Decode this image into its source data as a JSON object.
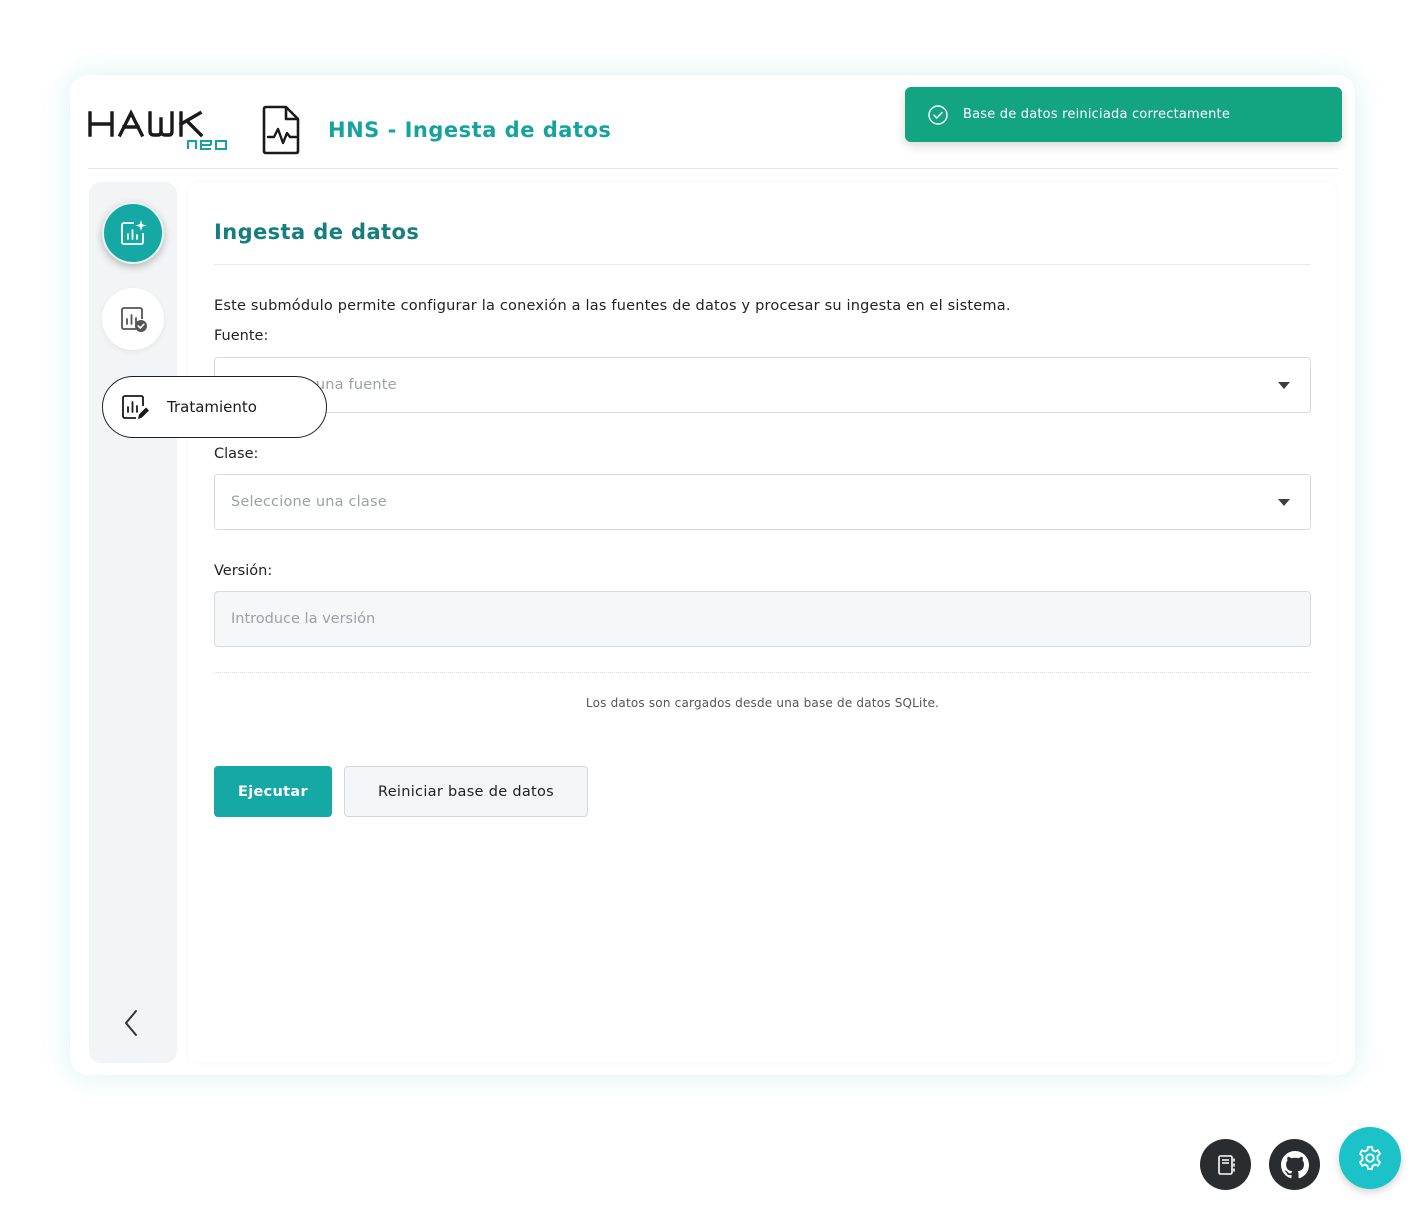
{
  "header": {
    "logo_text": "HAWK",
    "logo_subtext": "neo",
    "app_title": "HNS - Ingesta de datos"
  },
  "toast": {
    "message": "Base de datos reiniciada correctamente",
    "icon": "check-circle-icon"
  },
  "sidebar": {
    "items": [
      {
        "icon": "chart-sparkle-icon",
        "active": true
      },
      {
        "icon": "chart-check-icon",
        "active": false
      },
      {
        "icon": "chart-edit-icon",
        "label": "Tratamiento"
      }
    ],
    "collapse_icon": "chevron-left-icon"
  },
  "main": {
    "title": "Ingesta de datos",
    "description": "Este submódulo permite configurar la conexión a las fuentes de datos y procesar su ingesta en el sistema.",
    "fields": {
      "fuente": {
        "label": "Fuente:",
        "placeholder": "Seleccione una fuente"
      },
      "clase": {
        "label": "Clase:",
        "placeholder": "Seleccione una clase"
      },
      "version": {
        "label": "Versión:",
        "placeholder": "Introduce la versión"
      }
    },
    "note": "Los datos son cargados desde una base de datos SQLite.",
    "buttons": {
      "run": "Ejecutar",
      "reset": "Reiniciar base de datos"
    }
  },
  "fabs": [
    {
      "icon": "notebook-icon"
    },
    {
      "icon": "github-icon"
    },
    {
      "icon": "gear-icon"
    }
  ],
  "colors": {
    "primary": "#15a8a4",
    "title": "#147f7d",
    "toast": "#13a481",
    "fab_dark": "#2a2d30",
    "fab_settings": "#1bc2c7"
  }
}
